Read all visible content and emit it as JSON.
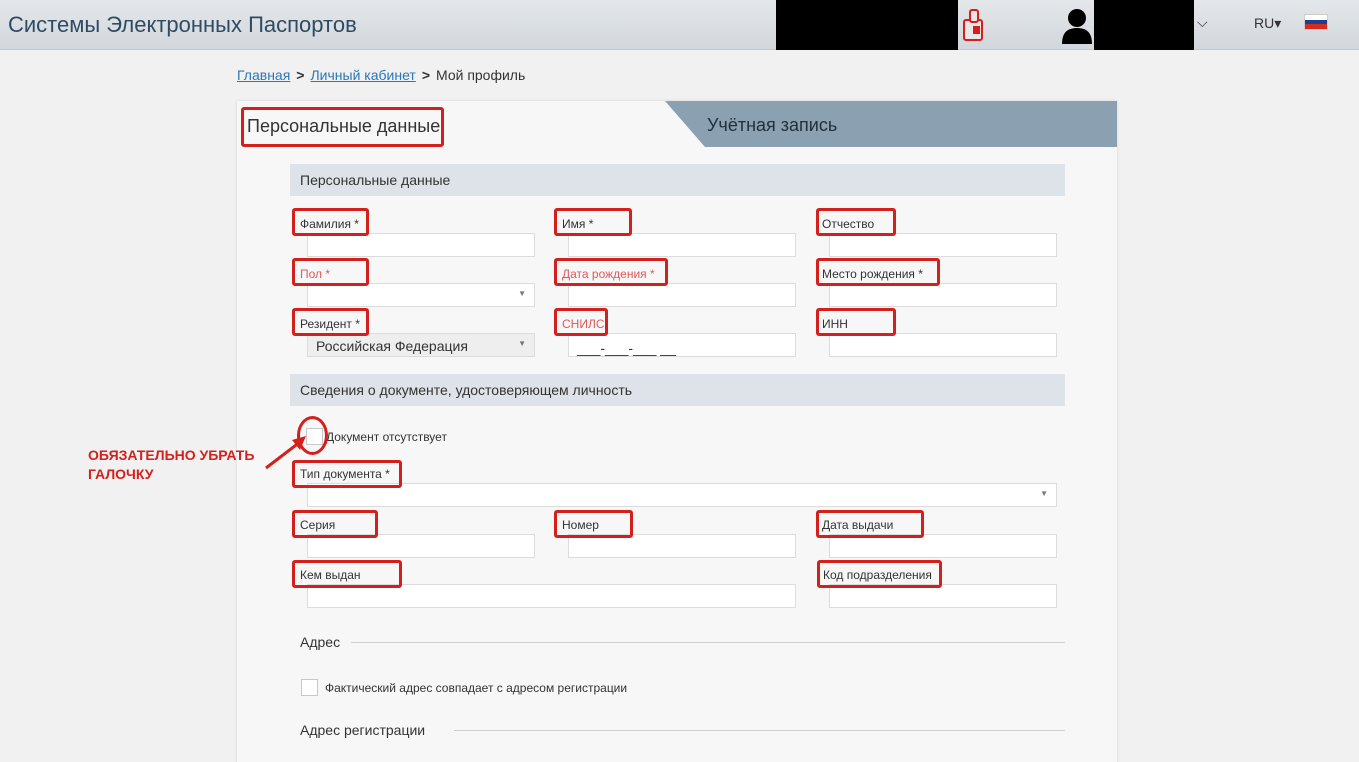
{
  "header": {
    "title": "Системы Электронных Паспортов",
    "lang": "RU",
    "colors": {
      "title": "#2f4b63",
      "flag": [
        "#ffffff",
        "#1c3f94",
        "#d52b1e"
      ]
    }
  },
  "breadcrumb": {
    "home": "Главная",
    "cabinet": "Личный кабинет",
    "current": "Мой профиль",
    "separator": ">"
  },
  "tabs": {
    "personal": "Персональные данные",
    "account": "Учётная запись"
  },
  "sections": {
    "personal": "Персональные данные",
    "document": "Сведения о документе, удостоверяющем личность"
  },
  "fields": {
    "last_name": {
      "label": "Фамилия *",
      "value": ""
    },
    "first_name": {
      "label": "Имя *",
      "value": ""
    },
    "patronymic": {
      "label": "Отчество",
      "value": ""
    },
    "gender": {
      "label": "Пол *",
      "value": ""
    },
    "birth_date": {
      "label": "Дата рождения *",
      "value": ""
    },
    "birth_place": {
      "label": "Место рождения *",
      "value": ""
    },
    "resident": {
      "label": "Резидент *",
      "value": "Российская Федерация"
    },
    "snils": {
      "label": "СНИЛС",
      "value": "___-___-___ __"
    },
    "inn": {
      "label": "ИНН",
      "value": ""
    },
    "doc_type": {
      "label": "Тип документа *",
      "value": ""
    },
    "series": {
      "label": "Серия",
      "value": ""
    },
    "number": {
      "label": "Номер",
      "value": ""
    },
    "issue_date": {
      "label": "Дата выдачи",
      "value": ""
    },
    "issued_by": {
      "label": "Кем выдан",
      "value": ""
    },
    "dept_code": {
      "label": "Код подразделения",
      "value": ""
    }
  },
  "checkboxes": {
    "no_document": "Документ отсутствует",
    "same_address": "Фактический адрес совпадает с адресом регистрации"
  },
  "address": {
    "title": "Адрес",
    "registration": "Адрес регистрации"
  },
  "annotation": {
    "note": "ОБЯЗАТЕЛЬНО УБРАТЬ ГАЛОЧКУ",
    "color": "#d4201c"
  }
}
